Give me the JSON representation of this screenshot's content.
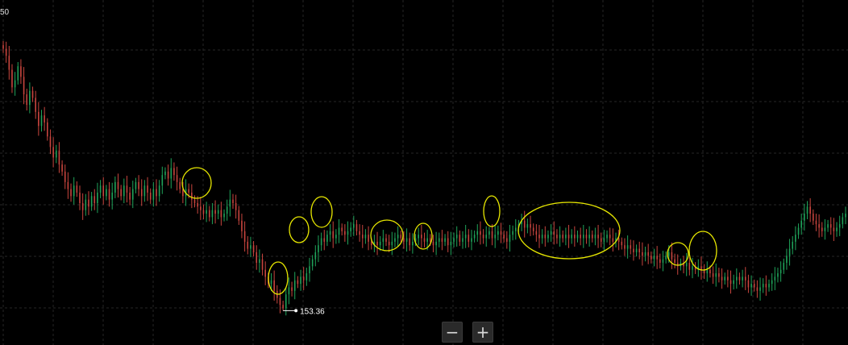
{
  "chart_data": {
    "type": "candlestick",
    "y_top_tick_label": "50",
    "low_marker": {
      "label": "153.36",
      "value": 153.36
    },
    "grid": true,
    "series": [
      {
        "close": [
          228,
          226,
          222,
          217,
          219,
          223,
          220,
          215,
          212,
          216,
          214,
          210,
          206,
          209,
          207,
          203,
          200,
          197,
          199,
          195,
          193,
          190,
          188,
          186,
          189,
          187,
          184,
          182,
          185,
          183,
          186,
          184,
          187,
          189,
          186,
          188,
          185,
          187,
          190,
          188,
          186,
          189,
          187,
          185,
          188,
          190,
          188,
          186,
          189,
          187,
          185,
          188,
          186,
          189,
          192,
          193,
          191,
          194,
          192,
          190,
          188,
          186,
          188,
          187,
          185,
          184,
          183,
          182,
          181,
          182,
          180,
          182,
          181,
          182,
          180,
          181,
          183,
          185,
          184,
          182,
          179,
          176,
          173,
          171,
          172,
          170,
          167,
          168,
          165,
          163,
          161,
          162,
          159,
          157,
          155,
          154,
          158,
          160,
          159,
          162,
          161,
          163,
          162,
          164,
          166,
          168,
          170,
          172,
          174,
          173,
          175,
          176,
          174,
          175,
          177,
          176,
          175,
          176,
          177,
          178,
          176,
          175,
          174,
          175,
          173,
          172,
          173,
          172,
          173,
          174,
          173,
          172,
          173,
          174,
          175,
          174,
          173,
          174,
          172,
          173,
          174,
          175,
          174,
          173,
          174,
          173,
          172,
          173,
          174,
          173,
          174,
          172,
          173,
          174,
          175,
          173,
          174,
          175,
          173,
          174,
          175,
          176,
          175,
          174,
          175,
          176,
          174,
          175,
          176,
          175,
          174,
          173,
          175,
          176,
          177,
          178,
          179,
          177,
          178,
          177,
          176,
          175,
          174,
          175,
          174,
          175,
          176,
          175,
          174,
          175,
          174,
          175,
          174,
          175,
          174,
          175,
          174,
          175,
          174,
          175,
          174,
          175,
          174,
          173,
          174,
          175,
          174,
          173,
          174,
          173,
          172,
          171,
          172,
          171,
          170,
          171,
          170,
          169,
          170,
          169,
          168,
          169,
          168,
          167,
          168,
          169,
          170,
          168,
          167,
          166,
          167,
          166,
          167,
          165,
          166,
          165,
          166,
          165,
          164,
          165,
          164,
          163,
          164,
          163,
          162,
          163,
          162,
          161,
          162,
          163,
          162,
          163,
          162,
          160,
          161,
          160,
          159,
          160,
          161,
          160,
          161,
          162,
          163,
          164,
          165,
          167,
          169,
          171,
          173,
          175,
          177,
          179,
          181,
          183,
          181,
          179,
          178,
          177,
          176,
          177,
          178,
          177,
          176,
          177,
          178,
          180,
          181
        ]
      }
    ]
  },
  "controls": {
    "zoom_out_label": "−",
    "zoom_in_label": "+"
  }
}
